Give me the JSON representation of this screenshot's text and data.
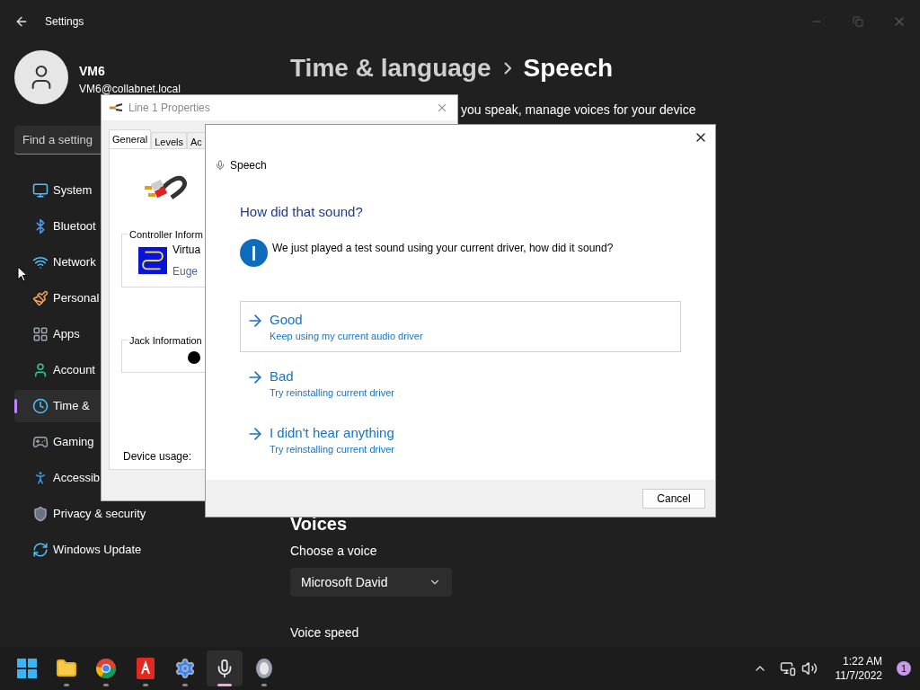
{
  "settings": {
    "title": "Settings",
    "user": {
      "name": "VM6",
      "email": "VM6@collabnet.local"
    },
    "search": {
      "placeholder": "Find a setting"
    },
    "nav": [
      {
        "label": "System",
        "kind": "system",
        "selected": false
      },
      {
        "label": "Bluetoot",
        "kind": "bluetooth",
        "selected": false
      },
      {
        "label": "Network",
        "kind": "network",
        "selected": false
      },
      {
        "label": "Personal",
        "kind": "personalization",
        "selected": false
      },
      {
        "label": "Apps",
        "kind": "apps",
        "selected": false
      },
      {
        "label": "Account",
        "kind": "accounts",
        "selected": false
      },
      {
        "label": "Time & ",
        "kind": "time",
        "selected": true
      },
      {
        "label": "Gaming",
        "kind": "gaming",
        "selected": false
      },
      {
        "label": "Accessib",
        "kind": "accessibility",
        "selected": false
      },
      {
        "label": "Privacy & security",
        "kind": "privacy",
        "selected": false
      },
      {
        "label": "Windows Update",
        "kind": "update",
        "selected": false
      }
    ],
    "breadcrumb": {
      "parent": "Time & language",
      "current": "Speech"
    },
    "description": "you speak, manage voices for your device",
    "voices_heading": "Voices",
    "voice_label": "Choose a voice",
    "voice_value": "Microsoft David",
    "speed_label": "Voice speed"
  },
  "properties": {
    "title": "Line 1 Properties",
    "tabs": [
      {
        "label": "General",
        "selected": true
      },
      {
        "label": "Levels",
        "selected": false
      },
      {
        "label": "Ac",
        "selected": false
      }
    ],
    "controller_group": "Controller Inform",
    "controller_name": "Virtua",
    "controller_vendor": "Euge",
    "jack_group": "Jack Information",
    "device_usage": "Device usage:"
  },
  "speech": {
    "title": "Speech",
    "heading": "How did that sound?",
    "message": "We just played a test sound using your current driver, how did it sound?",
    "options": [
      {
        "title": "Good",
        "subtitle": "Keep using my current audio driver",
        "selected": true
      },
      {
        "title": "Bad",
        "subtitle": "Try reinstalling current driver",
        "selected": false
      },
      {
        "title": "I didn't hear anything",
        "subtitle": "Try reinstalling current driver",
        "selected": false
      }
    ],
    "cancel": "Cancel"
  },
  "taskbar": {
    "apps": [
      {
        "kind": "start",
        "active": false
      },
      {
        "kind": "folder",
        "active": false
      },
      {
        "kind": "browser",
        "active": false
      },
      {
        "kind": "document",
        "active": false
      },
      {
        "kind": "gear",
        "active": false
      },
      {
        "kind": "mic",
        "active": true
      },
      {
        "kind": "speaker",
        "active": false
      }
    ],
    "time": "1:22 AM",
    "date": "11/7/2022",
    "badge": "1"
  }
}
